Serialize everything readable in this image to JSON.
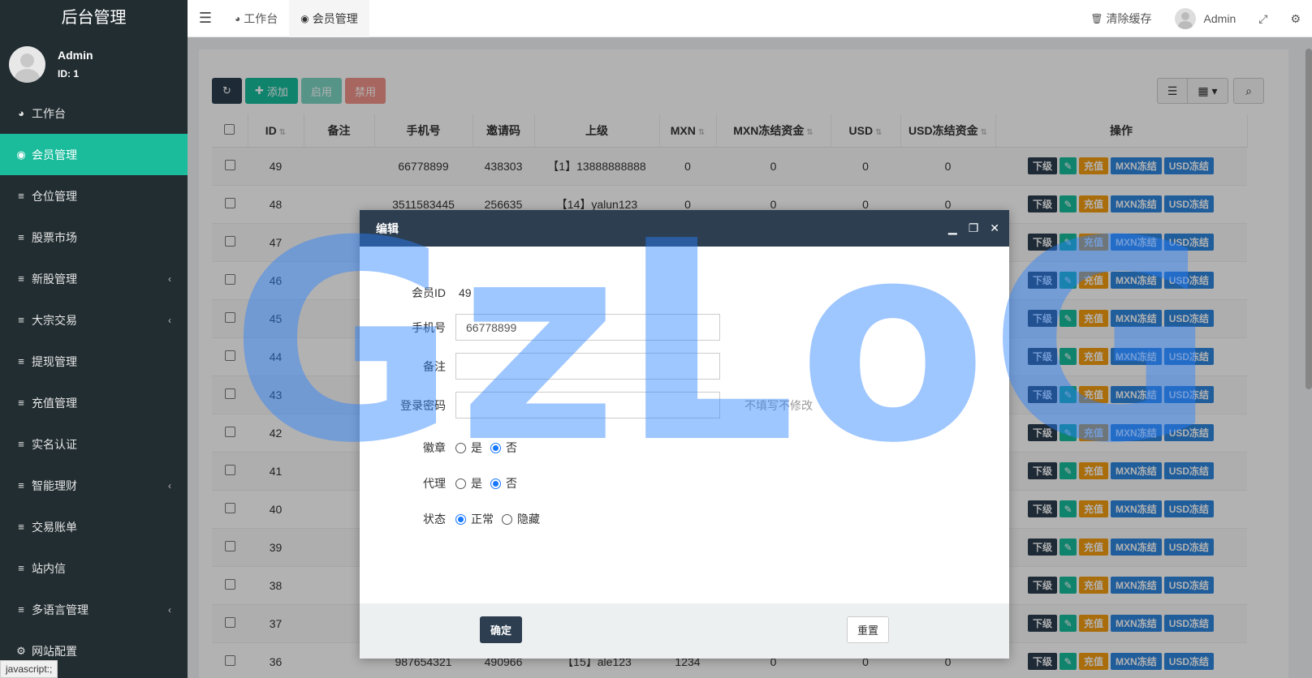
{
  "brand": "后台管理",
  "user": {
    "name": "Admin",
    "id": "ID: 1"
  },
  "menu": [
    {
      "icon": "dashboard-icon",
      "glyph": "◕",
      "label": "工作台",
      "chev": false,
      "active": false
    },
    {
      "icon": "user-circle-icon",
      "glyph": "◉",
      "label": "会员管理",
      "chev": false,
      "active": true
    },
    {
      "icon": "list-icon",
      "glyph": "≡",
      "label": "仓位管理",
      "chev": false,
      "active": false
    },
    {
      "icon": "list-icon",
      "glyph": "≡",
      "label": "股票市场",
      "chev": false,
      "active": false
    },
    {
      "icon": "list-icon",
      "glyph": "≡",
      "label": "新股管理",
      "chev": true,
      "active": false
    },
    {
      "icon": "list-icon",
      "glyph": "≡",
      "label": "大宗交易",
      "chev": true,
      "active": false
    },
    {
      "icon": "list-icon",
      "glyph": "≡",
      "label": "提现管理",
      "chev": false,
      "active": false
    },
    {
      "icon": "list-icon",
      "glyph": "≡",
      "label": "充值管理",
      "chev": false,
      "active": false
    },
    {
      "icon": "list-icon",
      "glyph": "≡",
      "label": "实名认证",
      "chev": false,
      "active": false
    },
    {
      "icon": "list-icon",
      "glyph": "≡",
      "label": "智能理财",
      "chev": true,
      "active": false
    },
    {
      "icon": "list-icon",
      "glyph": "≡",
      "label": "交易账单",
      "chev": false,
      "active": false
    },
    {
      "icon": "list-icon",
      "glyph": "≡",
      "label": "站内信",
      "chev": false,
      "active": false
    },
    {
      "icon": "list-icon",
      "glyph": "≡",
      "label": "多语言管理",
      "chev": true,
      "active": false
    },
    {
      "icon": "gear-icon",
      "glyph": "⚙",
      "label": "网站配置",
      "chev": false,
      "active": false
    }
  ],
  "tabs": [
    {
      "label": "工作台",
      "active": false
    },
    {
      "label": "会员管理",
      "active": true
    }
  ],
  "topbar": {
    "clear_cache": "清除缓存",
    "admin": "Admin"
  },
  "toolbar": {
    "add": "添加",
    "enable": "启用",
    "disable": "禁用"
  },
  "table": {
    "columns": [
      "ID",
      "备注",
      "手机号",
      "邀请码",
      "上级",
      "MXN",
      "MXN冻结资金",
      "USD",
      "USD冻结资金",
      "操作"
    ],
    "rows": [
      {
        "id": "49",
        "note": "",
        "phone": "66778899",
        "invite": "438303",
        "parent": "【1】13888888888",
        "mxn": "0",
        "mxn_f": "0",
        "usd": "0",
        "usd_f": "0"
      },
      {
        "id": "48",
        "note": "",
        "phone": "3511583445",
        "invite": "256635",
        "parent": "【14】yalun123",
        "mxn": "0",
        "mxn_f": "0",
        "usd": "0",
        "usd_f": "0"
      },
      {
        "id": "47",
        "note": "",
        "phone": "",
        "invite": "",
        "parent": "",
        "mxn": "",
        "mxn_f": "",
        "usd": "",
        "usd_f": ""
      },
      {
        "id": "46",
        "note": "",
        "phone": "",
        "invite": "",
        "parent": "",
        "mxn": "",
        "mxn_f": "",
        "usd": "",
        "usd_f": ""
      },
      {
        "id": "45",
        "note": "",
        "phone": "",
        "invite": "",
        "parent": "",
        "mxn": "",
        "mxn_f": "",
        "usd": "",
        "usd_f": ""
      },
      {
        "id": "44",
        "note": "",
        "phone": "",
        "invite": "",
        "parent": "",
        "mxn": "",
        "mxn_f": "",
        "usd": "",
        "usd_f": ""
      },
      {
        "id": "43",
        "note": "",
        "phone": "",
        "invite": "",
        "parent": "",
        "mxn": "",
        "mxn_f": "",
        "usd": "",
        "usd_f": ""
      },
      {
        "id": "42",
        "note": "",
        "phone": "",
        "invite": "",
        "parent": "",
        "mxn": "",
        "mxn_f": "",
        "usd": "",
        "usd_f": ""
      },
      {
        "id": "41",
        "note": "",
        "phone": "",
        "invite": "",
        "parent": "",
        "mxn": "",
        "mxn_f": "",
        "usd": "",
        "usd_f": ""
      },
      {
        "id": "40",
        "note": "",
        "phone": "",
        "invite": "",
        "parent": "",
        "mxn": "",
        "mxn_f": "",
        "usd": "",
        "usd_f": ""
      },
      {
        "id": "39",
        "note": "",
        "phone": "",
        "invite": "",
        "parent": "",
        "mxn": "",
        "mxn_f": "",
        "usd": "",
        "usd_f": ""
      },
      {
        "id": "38",
        "note": "",
        "phone": "",
        "invite": "",
        "parent": "",
        "mxn": "",
        "mxn_f": "",
        "usd": "",
        "usd_f": ""
      },
      {
        "id": "37",
        "note": "",
        "phone": "",
        "invite": "",
        "parent": "",
        "mxn": "",
        "mxn_f": "",
        "usd": "",
        "usd_f": ""
      },
      {
        "id": "36",
        "note": "",
        "phone": "987654321",
        "invite": "490966",
        "parent": "【15】ale123",
        "mxn": "1234",
        "mxn_f": "0",
        "usd": "0",
        "usd_f": "0"
      }
    ],
    "ops": {
      "sub": "下级",
      "recharge": "充值",
      "mxn_freeze": "MXN冻结",
      "usd_freeze": "USD冻结"
    }
  },
  "modal": {
    "title": "编辑",
    "fields": {
      "member_id_label": "会员ID",
      "member_id_value": "49",
      "phone_label": "手机号",
      "phone_value": "66778899",
      "note_label": "备注",
      "note_value": "",
      "password_label": "登录密码",
      "password_hint": "不填写不修改",
      "badge_label": "徽章",
      "agent_label": "代理",
      "status_label": "状态",
      "yes": "是",
      "no": "否",
      "normal": "正常",
      "hidden": "隐藏"
    },
    "confirm": "确定",
    "reset": "重置"
  },
  "watermark": "GzLoG",
  "statusbar": "javascript:;"
}
